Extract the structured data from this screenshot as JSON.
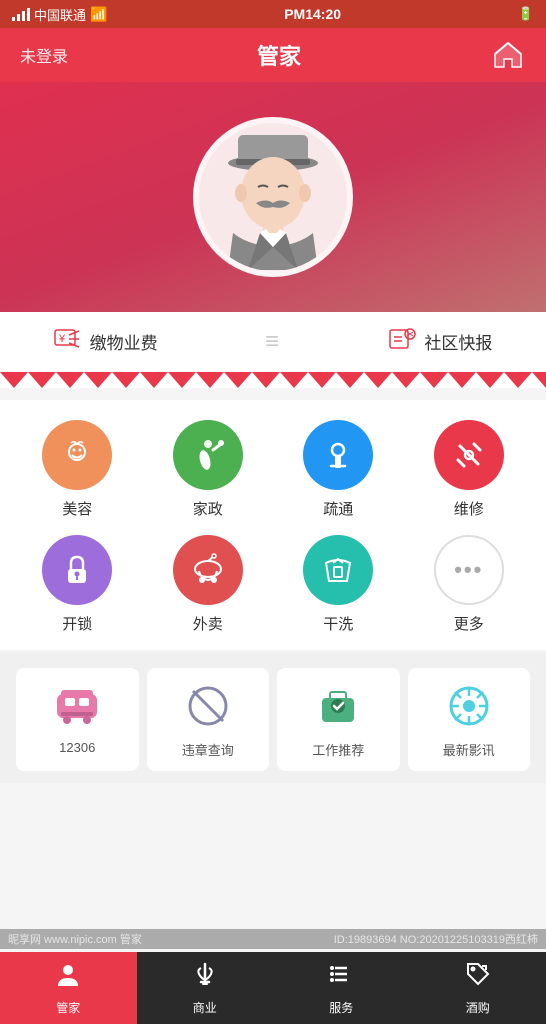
{
  "statusBar": {
    "carrier": "中国联通",
    "wifi": "WiFi",
    "time": "PM14:20",
    "signal": "signal"
  },
  "header": {
    "loginStatus": "未登录",
    "title": "管家",
    "homeIcon": "home"
  },
  "quickBar": {
    "item1Icon": "¥",
    "item1Label": "缴物业费",
    "divider": "≡",
    "item2Icon": "📋",
    "item2Label": "社区快报"
  },
  "services": [
    {
      "id": "beauty",
      "label": "美容",
      "color": "color-orange",
      "icon": "face"
    },
    {
      "id": "housekeep",
      "label": "家政",
      "color": "color-green",
      "icon": "brush"
    },
    {
      "id": "dredge",
      "label": "疏通",
      "color": "color-blue",
      "icon": "plunger"
    },
    {
      "id": "repair",
      "label": "维修",
      "color": "color-red",
      "icon": "wrench"
    },
    {
      "id": "unlock",
      "label": "开锁",
      "color": "color-purple",
      "icon": "lock"
    },
    {
      "id": "takeout",
      "label": "外卖",
      "color": "color-dark-red",
      "icon": "scooter"
    },
    {
      "id": "laundry",
      "label": "干洗",
      "color": "color-teal",
      "icon": "hanger"
    },
    {
      "id": "more",
      "label": "更多",
      "color": "color-light-gray",
      "icon": "more"
    }
  ],
  "features": [
    {
      "id": "train",
      "label": "12306",
      "icon": "train"
    },
    {
      "id": "violation",
      "label": "违章查询",
      "icon": "ban"
    },
    {
      "id": "job",
      "label": "工作推荐",
      "icon": "briefcase"
    },
    {
      "id": "movie",
      "label": "最新影讯",
      "icon": "film"
    }
  ],
  "tabBar": {
    "tabs": [
      {
        "id": "home",
        "label": "管家",
        "icon": "person",
        "active": true
      },
      {
        "id": "shop",
        "label": "商业",
        "icon": "tie"
      },
      {
        "id": "service",
        "label": "服务",
        "icon": "list"
      },
      {
        "id": "tag",
        "label": "酒购",
        "icon": "tag"
      }
    ]
  },
  "watermark": {
    "left": "昵享网 www.nipic.com 管家",
    "right": "ID:19893694 NO:20201225103319西红柿"
  }
}
